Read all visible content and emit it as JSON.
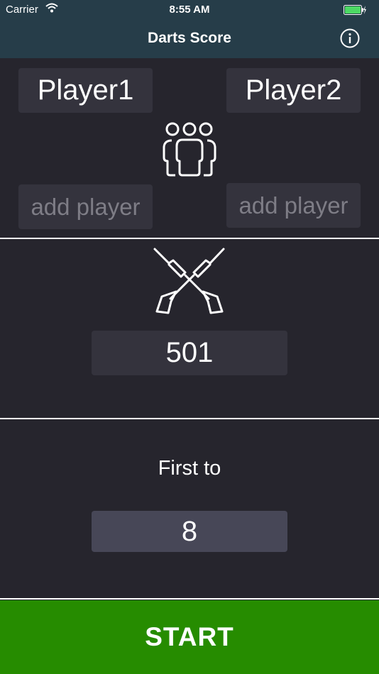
{
  "status_bar": {
    "carrier": "Carrier",
    "time": "8:55 AM"
  },
  "nav": {
    "title": "Darts Score",
    "info_icon": "info-icon"
  },
  "players": {
    "player1": "Player1",
    "player2": "Player2",
    "add_player_left_placeholder": "add player",
    "add_player_right_placeholder": "add player",
    "icon": "group-icon"
  },
  "game": {
    "darts_icon": "crossed-darts-icon",
    "score": "501"
  },
  "match": {
    "first_to_label": "First to",
    "legs": "8"
  },
  "actions": {
    "start_label": "START"
  },
  "colors": {
    "nav_background": "#263d49",
    "background": "#26252d",
    "field": "#34333d",
    "start_button": "#268c00"
  }
}
